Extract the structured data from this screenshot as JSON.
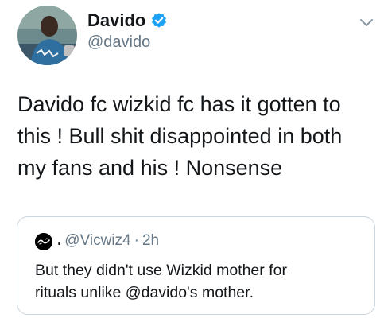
{
  "tweet": {
    "author_name": "Davido",
    "author_handle": "@davido",
    "verified": true,
    "text_lines": [
      "Davido fc wizkid fc has it gotten to",
      "this ! Bull shit disappointed in both",
      "my fans and his ! Nonsense"
    ]
  },
  "quoted_tweet": {
    "name_prefix": ".",
    "handle": "@Vicwiz4",
    "separator": "·",
    "time": "2h",
    "text_lines": [
      "But they didn't use Wizkid mother for",
      "rituals unlike @davido's mother."
    ]
  },
  "colors": {
    "verified_blue": "#1da1f2",
    "secondary_text": "#657786",
    "border": "#ccd6dd"
  },
  "icons": {
    "verified": "verified-badge-icon",
    "menu": "chevron-down-icon"
  }
}
